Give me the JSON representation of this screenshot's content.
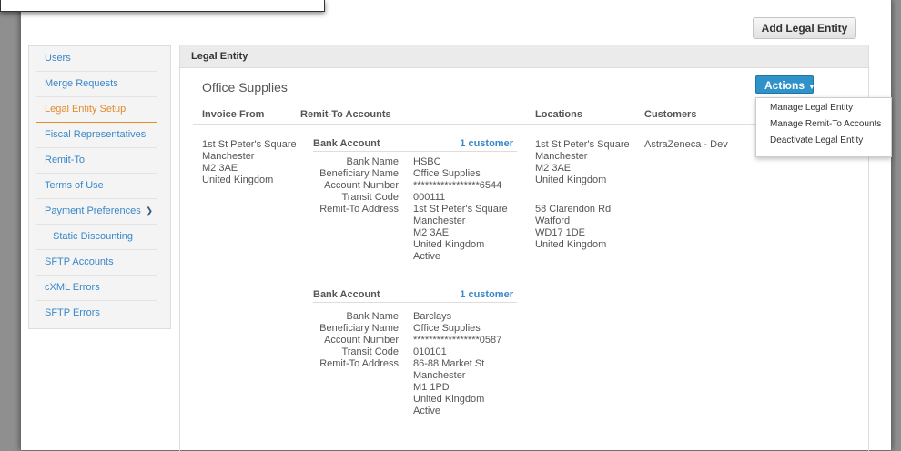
{
  "toolbar": {
    "add_legal_entity": "Add Legal Entity"
  },
  "sidebar": {
    "items": [
      {
        "label": "Users"
      },
      {
        "label": "Merge Requests"
      },
      {
        "label": "Legal Entity Setup"
      },
      {
        "label": "Fiscal Representatives"
      },
      {
        "label": "Remit-To"
      },
      {
        "label": "Terms of Use"
      },
      {
        "label": "Payment Preferences"
      },
      {
        "label": "Static Discounting"
      },
      {
        "label": "SFTP Accounts"
      },
      {
        "label": "cXML Errors"
      },
      {
        "label": "SFTP Errors"
      }
    ],
    "active": "Legal Entity Setup"
  },
  "panel": {
    "header": "Legal Entity",
    "entity_name": "Office Supplies",
    "actions_label": "Actions",
    "columns": [
      "Invoice From",
      "Remit-To Accounts",
      "Locations",
      "Customers"
    ],
    "invoice_from": [
      "1st St Peter's Square",
      "Manchester",
      "M2 3AE",
      "United Kingdom"
    ],
    "bank_accounts": [
      {
        "title": "Bank Account",
        "customer_link": "1 customer",
        "labels": [
          "Bank Name",
          "Beneficiary Name",
          "Account Number",
          "Transit Code",
          "Remit-To Address"
        ],
        "values": [
          "HSBC",
          "Office Supplies",
          "*****************6544",
          "000111",
          "1st St Peter's Square",
          "Manchester",
          "M2 3AE",
          "United Kingdom",
          "Active"
        ]
      },
      {
        "title": "Bank Account",
        "customer_link": "1 customer",
        "labels": [
          "Bank Name",
          "Beneficiary Name",
          "Account Number",
          "Transit Code",
          "Remit-To Address"
        ],
        "values": [
          "Barclays",
          "Office Supplies",
          "*****************0587",
          "010101",
          "86-88 Market St",
          "Manchester",
          "M1 1PD",
          "United Kingdom",
          "Active"
        ]
      }
    ],
    "locations": [
      [
        "1st St Peter's Square",
        "Manchester",
        "M2 3AE",
        "United Kingdom"
      ],
      [
        "58 Clarendon Rd",
        "Watford",
        "WD17 1DE",
        "United Kingdom"
      ]
    ],
    "customers": [
      "AstraZeneca - Dev"
    ]
  },
  "actions_menu": {
    "items": [
      "Manage Legal Entity",
      "Manage Remit-To Accounts",
      "Deactivate Legal Entity"
    ]
  }
}
